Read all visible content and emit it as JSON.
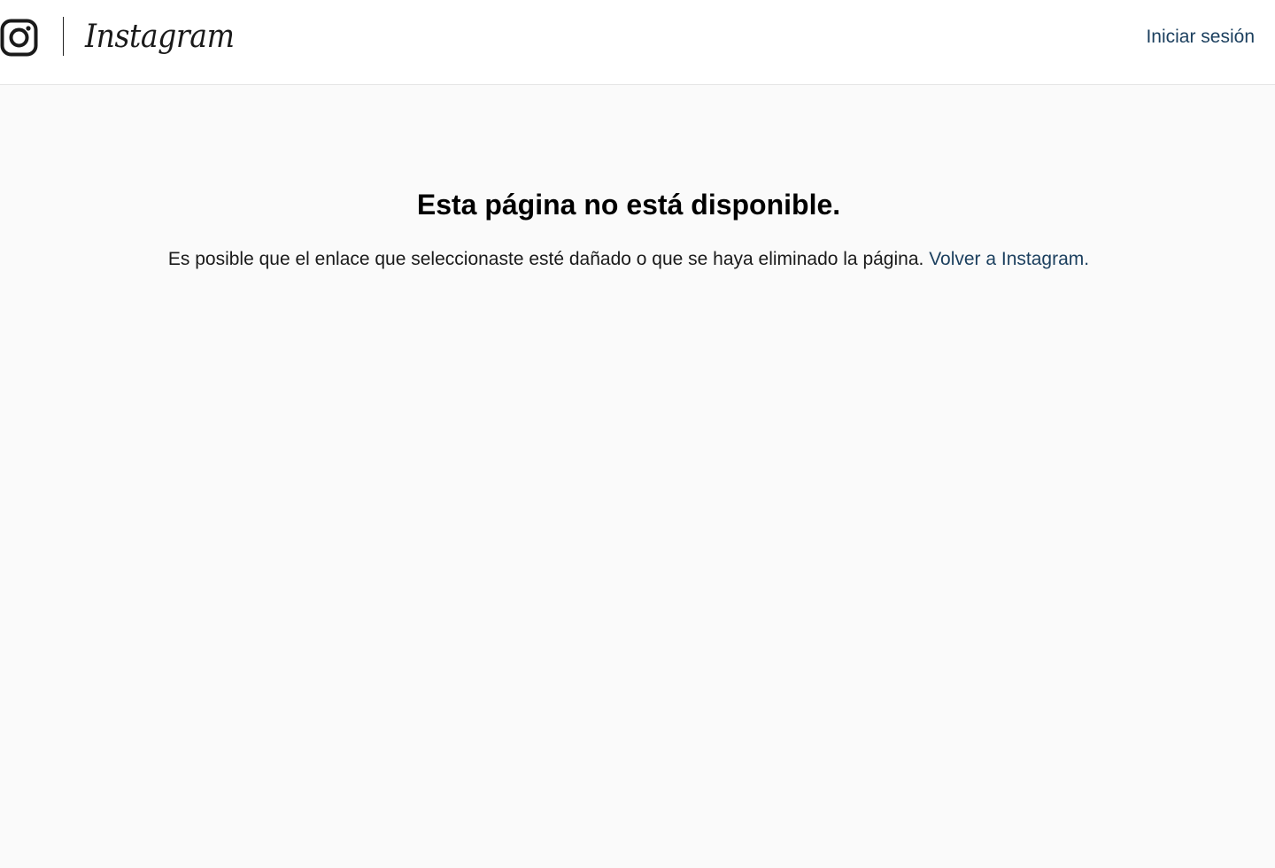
{
  "header": {
    "brand_icon": "instagram-camera-icon",
    "brand_wordmark": "Instagram",
    "login_label": "Iniciar sesión"
  },
  "main": {
    "title": "Esta página no está disponible.",
    "message": "Es posible que el enlace que seleccionaste esté dañado o que se haya eliminado la página.",
    "back_link_label": "Volver a Instagram."
  },
  "colors": {
    "link": "#1b3f5e",
    "page_background": "#fafafa",
    "header_background": "#ffffff",
    "text": "#000000"
  }
}
